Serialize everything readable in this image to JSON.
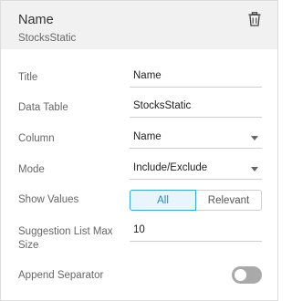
{
  "header": {
    "title": "Name",
    "subtitle": "StocksStatic"
  },
  "fields": {
    "title": {
      "label": "Title",
      "value": "Name"
    },
    "data_table": {
      "label": "Data Table",
      "value": "StocksStatic"
    },
    "column": {
      "label": "Column",
      "value": "Name"
    },
    "mode": {
      "label": "Mode",
      "value": "Include/Exclude"
    },
    "show_values": {
      "label": "Show Values",
      "options": [
        "All",
        "Relevant"
      ],
      "selected": "All"
    },
    "suggestion_list_max_size": {
      "label_line1": "Suggestion List Max",
      "label_line2": "Size",
      "value": "10"
    },
    "append_separator": {
      "label": "Append Separator",
      "enabled": false
    }
  },
  "colors": {
    "accent": "#37a9d8",
    "header_bg": "#f1f1f1",
    "toggle_off": "#a9a9a9"
  },
  "icons": {
    "delete": "trash-icon",
    "dropdown": "chevron-down-icon"
  }
}
